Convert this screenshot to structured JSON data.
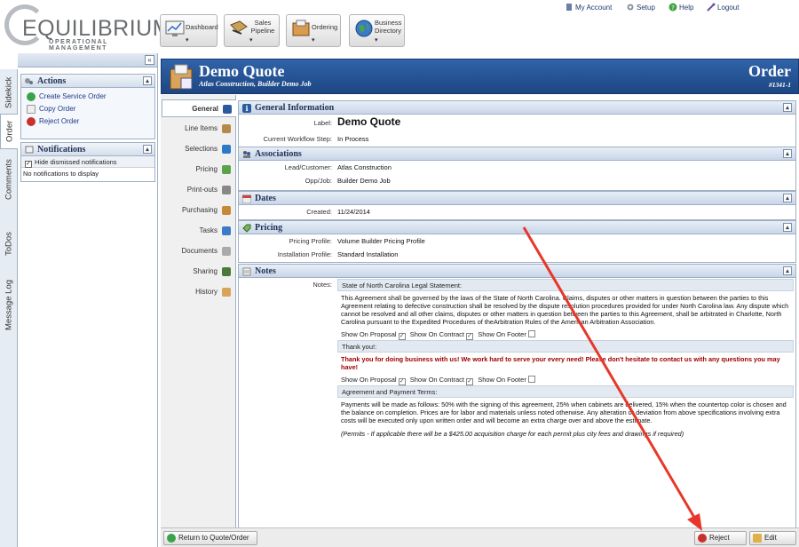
{
  "header": {
    "logo_word": "EQUILIBRIUM",
    "logo_sub": "OPERATIONAL MANAGEMENT",
    "nav": [
      {
        "label": "Dashboard",
        "icon": "dashboard-icon"
      },
      {
        "label": "Sales Pipeline",
        "icon": "pipeline-icon"
      },
      {
        "label": "Ordering",
        "icon": "ordering-icon"
      },
      {
        "label": "Business Directory",
        "icon": "globe-icon"
      }
    ],
    "links": {
      "account": "My Account",
      "setup": "Setup",
      "help": "Help",
      "logout": "Logout"
    }
  },
  "vtabs": [
    "Sidekick",
    "Order",
    "Comments",
    "ToDos",
    "Message Log"
  ],
  "sidekick": {
    "collapse_glyph": "«",
    "actions": {
      "title": "Actions",
      "items": [
        "Create Service Order",
        "Copy Order",
        "Reject Order"
      ]
    },
    "notifications": {
      "title": "Notifications",
      "hide_label": "Hide dismissed notifications",
      "hide_checked": true,
      "empty_text": "No notifications to display"
    }
  },
  "order": {
    "title": "Demo Quote",
    "subtitle": "Atlas Construction, Builder Demo Job",
    "type": "Order",
    "number": "#1341-1"
  },
  "tabs": [
    {
      "label": "General",
      "icon": "info-icon",
      "active": true
    },
    {
      "label": "Line Items",
      "icon": "line-items-icon"
    },
    {
      "label": "Selections",
      "icon": "selections-icon"
    },
    {
      "label": "Pricing",
      "icon": "pricing-icon"
    },
    {
      "label": "Print-outs",
      "icon": "printouts-icon"
    },
    {
      "label": "Purchasing",
      "icon": "purchasing-icon"
    },
    {
      "label": "Tasks",
      "icon": "tasks-icon"
    },
    {
      "label": "Documents",
      "icon": "documents-icon"
    },
    {
      "label": "Sharing",
      "icon": "sharing-icon"
    },
    {
      "label": "History",
      "icon": "history-icon"
    }
  ],
  "general": {
    "title": "General Information",
    "label_label": "Label:",
    "label_value": "Demo Quote",
    "step_label": "Current Workflow Step:",
    "step_value": "In Process"
  },
  "associations": {
    "title": "Associations",
    "lead_label": "Lead/Customer:",
    "lead_value": "Atlas Construction",
    "opp_label": "Opp/Job:",
    "opp_value": "Builder Demo Job"
  },
  "dates": {
    "title": "Dates",
    "created_label": "Created:",
    "created_value": "11/24/2014"
  },
  "pricing": {
    "title": "Pricing",
    "profile_label": "Pricing Profile:",
    "profile_value": "Volume Builder Pricing Profile",
    "install_label": "Installation Profile:",
    "install_value": "Standard Installation"
  },
  "notes": {
    "title": "Notes",
    "label": "Notes:",
    "flag_labels": {
      "proposal": "Show On Proposal",
      "contract": "Show On Contract",
      "footer": "Show On Footer"
    },
    "entries": [
      {
        "header": "State of North Carolina Legal Statement:",
        "body": "This Agreement shall be governed by the laws of the State of North Carolina. Claims, disputes or other matters in question between the parties to this Agreement relating to defective construction shall be resolved by the dispute resolution procedures provided for under North Carolina law. Any dispute which cannot be resolved and all other claims, disputes or other matters in question between the parties to this Agreement, shall be arbitrated in Charlotte, North Carolina pursuant to the Expedited Procedures of theArbitration Rules of the American Arbitration Association.",
        "show_proposal": true,
        "show_contract": true,
        "show_footer": false
      },
      {
        "header": "Thank you!:",
        "body": "Thank you for doing business with us! We work hard to serve your every need! Please don't hesitate to contact us with any questions you may have!",
        "show_proposal": true,
        "show_contract": true,
        "show_footer": false
      },
      {
        "header": "Agreement and Payment Terms:",
        "body": "Payments will be made as follows: 50% with the signing of this agreement, 25% when cabinets are delivered, 15% when the countertop color is chosen and the balance on completion. Prices are for labor and materials unless noted otherwise. Any alteration or deviation from above specifications involving extra costs will be executed only upon written order and will become an extra charge over and above the estimate.",
        "body2": "(Permits - If applicable there will be a $425.00 acquisition charge for each permit plus city fees and drawings if required)"
      }
    ]
  },
  "bottom": {
    "return_label": "Return to Quote/Order List",
    "reject_label": "Reject Order",
    "edit_label": "Edit Order"
  },
  "colors": {
    "title_bar": "#2a5aa0",
    "annotation_arrow": "#e8372a",
    "accent_text": "#a00000"
  }
}
